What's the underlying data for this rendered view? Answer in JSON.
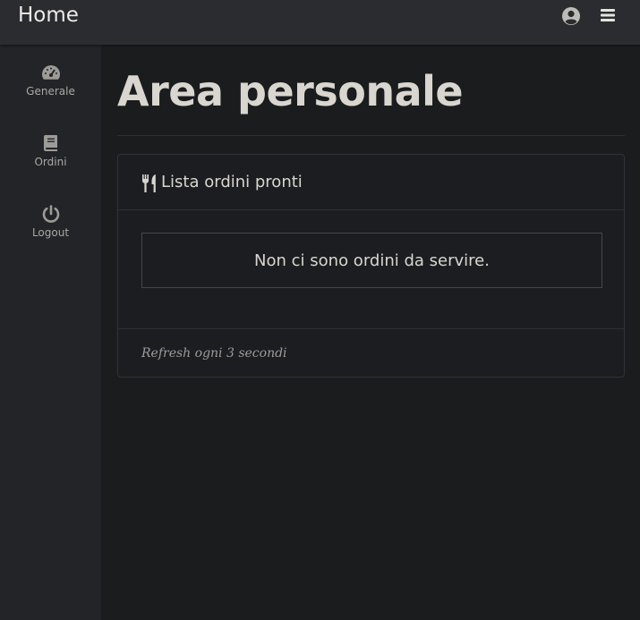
{
  "navbar": {
    "brand": "Home",
    "icons": [
      "user-circle-icon",
      "hamburger-menu-icon"
    ]
  },
  "sidebar": {
    "items": [
      {
        "label": "Generale",
        "icon": "speedometer-icon"
      },
      {
        "label": "Ordini",
        "icon": "book-icon"
      },
      {
        "label": "Logout",
        "icon": "power-icon"
      }
    ]
  },
  "main": {
    "title": "Area personale",
    "card": {
      "icon": "utensils-icon",
      "title": "Lista ordini pronti",
      "empty_message": "Non ci sono ordini da servire.",
      "footer": "Refresh ogni 3 secondi"
    }
  },
  "colors": {
    "background": "#1b1c1e",
    "navbar": "#2b2c2f",
    "sidebar": "#232427",
    "text": "#d9d6d0",
    "muted": "#a9a8a4"
  }
}
